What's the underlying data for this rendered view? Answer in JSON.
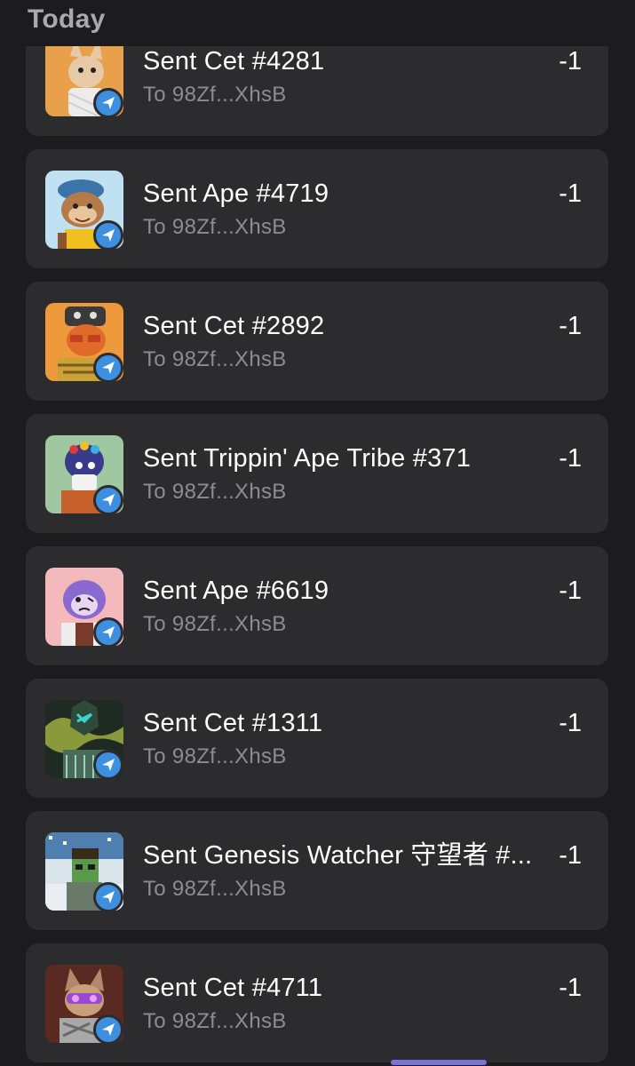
{
  "section": {
    "title": "Today"
  },
  "transactions": [
    {
      "title": "Sent Cet #4281",
      "subtitle": "To 98Zf...XhsB",
      "amount": "-1",
      "icon": "send-arrow-icon",
      "thumb_color": "#e9a04a"
    },
    {
      "title": "Sent Ape #4719",
      "subtitle": "To 98Zf...XhsB",
      "amount": "-1",
      "icon": "send-arrow-icon",
      "thumb_color": "#bfe1f2"
    },
    {
      "title": "Sent Cet #2892",
      "subtitle": "To 98Zf...XhsB",
      "amount": "-1",
      "icon": "send-arrow-icon",
      "thumb_color": "#ee9a3c"
    },
    {
      "title": "Sent Trippin' Ape Tribe #371",
      "subtitle": "To 98Zf...XhsB",
      "amount": "-1",
      "icon": "send-arrow-icon",
      "thumb_color": "#9fc7a1"
    },
    {
      "title": "Sent Ape #6619",
      "subtitle": "To 98Zf...XhsB",
      "amount": "-1",
      "icon": "send-arrow-icon",
      "thumb_color": "#f3b9bd"
    },
    {
      "title": "Sent Cet #1311",
      "subtitle": "To 98Zf...XhsB",
      "amount": "-1",
      "icon": "send-arrow-icon",
      "thumb_color": "#1e2a22"
    },
    {
      "title": "Sent Genesis Watcher 守望者 #...",
      "subtitle": "To 98Zf...XhsB",
      "amount": "-1",
      "icon": "send-arrow-icon",
      "thumb_color": "#d8e4ea"
    },
    {
      "title": "Sent Cet #4711",
      "subtitle": "To 98Zf...XhsB",
      "amount": "-1",
      "icon": "send-arrow-icon",
      "thumb_color": "#5a2a22"
    }
  ],
  "colors": {
    "background": "#1c1c1e",
    "card": "#2c2c2f",
    "accent": "#3d8fe0",
    "subtitle": "#8c8c91",
    "home_indicator": "#7b72d9"
  }
}
